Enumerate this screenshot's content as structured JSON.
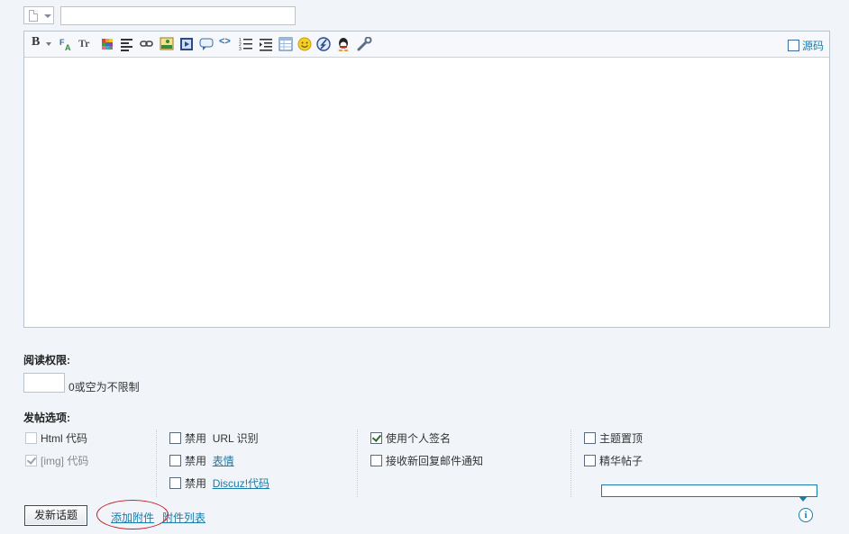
{
  "subject": {
    "value": ""
  },
  "editor": {
    "source_label": "源码",
    "toolbar_icons": [
      "bold-icon",
      "font-icon",
      "font-size-icon",
      "color-icon",
      "align-icon",
      "link-icon",
      "image-icon",
      "media-icon",
      "quote-icon",
      "code-icon",
      "ordered-list-icon",
      "indent-icon",
      "table-icon",
      "smiley-icon",
      "flash-icon",
      "qq-icon",
      "tools-icon"
    ],
    "content": ""
  },
  "read_permission": {
    "title": "阅读权限:",
    "value": "",
    "hint": "0或空为不限制"
  },
  "post_options": {
    "title": "发帖选项:",
    "col1": [
      {
        "label": "Html 代码",
        "checked": false,
        "disabled": true
      },
      {
        "label": "[img] 代码",
        "checked": true,
        "disabled": true
      }
    ],
    "col2": [
      {
        "prefix": "禁用",
        "label": "URL 识别",
        "link": false,
        "checked": false
      },
      {
        "prefix": "禁用",
        "label": "表情",
        "link": true,
        "checked": false
      },
      {
        "prefix": "禁用",
        "label": "Discuz!代码",
        "link": true,
        "checked": false
      }
    ],
    "col3": [
      {
        "label": "使用个人签名",
        "checked": true
      },
      {
        "label": "接收新回复邮件通知",
        "checked": false
      }
    ],
    "col4": [
      {
        "label": "主题置顶",
        "checked": false
      },
      {
        "label": "精华帖子",
        "checked": false
      }
    ]
  },
  "footer": {
    "submit_label": "发新话题",
    "attach_label": "添加附件",
    "attach_list_label": "附件列表",
    "info_glyph": "i"
  },
  "colors": {
    "background": "#f1f5fa",
    "link": "#1a7ba8",
    "annotation": "#c0202a"
  }
}
